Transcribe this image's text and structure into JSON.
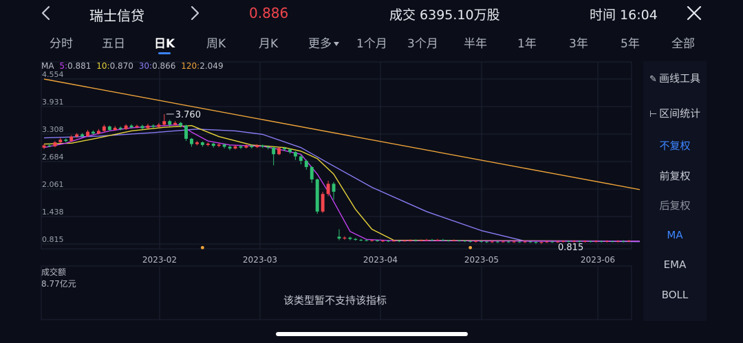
{
  "header": {
    "stock_name": "瑞士信贷",
    "price": "0.886",
    "volume": "成交 6395.10万股",
    "time": "时间 16:04",
    "price_color": "#f2454d"
  },
  "tabs": [
    {
      "label": "分时"
    },
    {
      "label": "五日"
    },
    {
      "label": "日K",
      "active": true
    },
    {
      "label": "周K"
    },
    {
      "label": "月K"
    },
    {
      "label": "更多"
    },
    {
      "label": "1个月"
    },
    {
      "label": "3个月"
    },
    {
      "label": "半年"
    },
    {
      "label": "1年"
    },
    {
      "label": "3年"
    },
    {
      "label": "5年"
    },
    {
      "label": "全部"
    }
  ],
  "ma_legend": {
    "prefix": "MA",
    "ma5": {
      "label": "5:",
      "value": "0.881",
      "color": "#c340f0"
    },
    "ma10": {
      "label": "10:",
      "value": "0.870",
      "color": "#e8d43a"
    },
    "ma30": {
      "label": "30:",
      "value": "0.866",
      "color": "#8a7cf5"
    },
    "ma120": {
      "label": "120:",
      "value": "2.049",
      "color": "#f0a43a"
    }
  },
  "side_panel": {
    "draw_tools": "画线工具",
    "interval_stats": "区间统计",
    "no_adjust": "不复权",
    "forward_adjust": "前复权",
    "backward_adjust": "后复权",
    "ma": "MA",
    "ema": "EMA",
    "boll": "BOLL"
  },
  "volume_panel": {
    "title": "成交额",
    "value": "8.77亿元",
    "message": "该类型暂不支持该指标"
  },
  "chart_data": {
    "type": "candlestick",
    "y_ticks": [
      "4.554",
      "3.931",
      "3.308",
      "2.684",
      "2.061",
      "1.438",
      "0.815"
    ],
    "ylim": [
      0.815,
      4.554
    ],
    "x_ticks": [
      "2023-02",
      "2023-03",
      "2023-04",
      "2023-05",
      "2023-06"
    ],
    "annotations": {
      "high": "3.760",
      "low": "0.815"
    },
    "colors": {
      "up": "#f2454d",
      "down": "#2fbf71",
      "ma5": "#c340f0",
      "ma10": "#e8d43a",
      "ma30": "#8a7cf5",
      "ma120": "#f0a43a",
      "grid": "#1c2133"
    },
    "candles": [
      [
        3.0,
        3.05,
        2.97,
        3.08
      ],
      [
        3.05,
        3.03,
        3.01,
        3.09
      ],
      [
        3.03,
        3.12,
        3.01,
        3.15
      ],
      [
        3.12,
        3.18,
        3.1,
        3.22
      ],
      [
        3.18,
        3.15,
        3.12,
        3.21
      ],
      [
        3.15,
        3.25,
        3.13,
        3.28
      ],
      [
        3.25,
        3.3,
        3.22,
        3.33
      ],
      [
        3.3,
        3.26,
        3.23,
        3.33
      ],
      [
        3.26,
        3.36,
        3.24,
        3.4
      ],
      [
        3.36,
        3.32,
        3.29,
        3.39
      ],
      [
        3.32,
        3.38,
        3.3,
        3.42
      ],
      [
        3.38,
        3.48,
        3.35,
        3.52
      ],
      [
        3.48,
        3.4,
        3.37,
        3.5
      ],
      [
        3.4,
        3.45,
        3.38,
        3.49
      ],
      [
        3.45,
        3.42,
        3.39,
        3.48
      ],
      [
        3.42,
        3.5,
        3.4,
        3.53
      ],
      [
        3.5,
        3.46,
        3.43,
        3.53
      ],
      [
        3.46,
        3.49,
        3.44,
        3.52
      ],
      [
        3.49,
        3.44,
        3.41,
        3.52
      ],
      [
        3.44,
        3.5,
        3.42,
        3.54
      ],
      [
        3.5,
        3.47,
        3.44,
        3.53
      ],
      [
        3.47,
        3.52,
        3.45,
        3.56
      ],
      [
        3.52,
        3.6,
        3.5,
        3.76
      ],
      [
        3.6,
        3.52,
        3.48,
        3.63
      ],
      [
        3.52,
        3.56,
        3.5,
        3.6
      ],
      [
        3.56,
        3.5,
        3.46,
        3.58
      ],
      [
        3.5,
        3.2,
        3.15,
        3.52
      ],
      [
        3.2,
        3.08,
        3.02,
        3.22
      ],
      [
        3.08,
        3.12,
        3.05,
        3.15
      ],
      [
        3.12,
        3.06,
        3.02,
        3.14
      ],
      [
        3.06,
        3.09,
        3.03,
        3.12
      ],
      [
        3.09,
        3.04,
        3.0,
        3.11
      ],
      [
        3.04,
        3.07,
        3.01,
        3.1
      ],
      [
        3.07,
        3.02,
        2.98,
        3.09
      ],
      [
        3.02,
        2.98,
        2.94,
        3.05
      ],
      [
        2.98,
        3.03,
        2.96,
        3.06
      ],
      [
        3.03,
        3.0,
        2.97,
        3.06
      ],
      [
        3.0,
        3.04,
        2.98,
        3.07
      ],
      [
        3.04,
        3.01,
        2.98,
        3.06
      ],
      [
        3.01,
        3.05,
        2.99,
        3.08
      ],
      [
        3.05,
        3.02,
        2.99,
        3.07
      ],
      [
        3.02,
        3.0,
        2.96,
        3.05
      ],
      [
        3.0,
        2.85,
        2.6,
        3.02
      ],
      [
        2.85,
        2.99,
        2.83,
        3.02
      ],
      [
        2.99,
        2.96,
        2.92,
        3.02
      ],
      [
        2.96,
        2.9,
        2.86,
        2.98
      ],
      [
        2.9,
        2.8,
        2.72,
        2.92
      ],
      [
        2.8,
        2.7,
        2.62,
        2.83
      ],
      [
        2.7,
        2.56,
        2.5,
        2.73
      ],
      [
        2.56,
        2.28,
        2.2,
        2.58
      ],
      [
        2.28,
        1.55,
        1.5,
        2.3
      ],
      [
        1.55,
        1.95,
        1.52,
        2.0
      ],
      [
        1.95,
        2.18,
        1.9,
        2.25
      ],
      [
        2.18,
        2.0,
        1.82,
        2.22
      ],
      [
        0.98,
        0.94,
        0.9,
        1.15
      ],
      [
        0.94,
        0.96,
        0.91,
        0.99
      ],
      [
        0.96,
        0.93,
        0.9,
        0.98
      ],
      [
        0.93,
        0.91,
        0.89,
        0.95
      ],
      [
        0.91,
        0.9,
        0.88,
        0.93
      ],
      [
        0.9,
        0.89,
        0.88,
        0.92
      ],
      [
        0.89,
        0.9,
        0.87,
        0.92
      ],
      [
        0.9,
        0.88,
        0.87,
        0.91
      ],
      [
        0.88,
        0.89,
        0.86,
        0.91
      ],
      [
        0.89,
        0.88,
        0.86,
        0.9
      ],
      [
        0.88,
        0.89,
        0.87,
        0.91
      ],
      [
        0.89,
        0.88,
        0.86,
        0.9
      ],
      [
        0.88,
        0.89,
        0.87,
        0.91
      ],
      [
        0.89,
        0.9,
        0.87,
        0.92
      ],
      [
        0.9,
        0.89,
        0.87,
        0.92
      ],
      [
        0.89,
        0.9,
        0.88,
        0.92
      ],
      [
        0.9,
        0.91,
        0.88,
        0.93
      ],
      [
        0.91,
        0.9,
        0.88,
        0.93
      ],
      [
        0.9,
        0.91,
        0.89,
        0.93
      ],
      [
        0.91,
        0.9,
        0.88,
        0.93
      ],
      [
        0.9,
        0.89,
        0.87,
        0.91
      ],
      [
        0.89,
        0.9,
        0.88,
        0.92
      ],
      [
        0.9,
        0.89,
        0.87,
        0.91
      ],
      [
        0.89,
        0.88,
        0.86,
        0.9
      ],
      [
        0.88,
        0.87,
        0.85,
        0.89
      ],
      [
        0.87,
        0.88,
        0.85,
        0.9
      ],
      [
        0.88,
        0.87,
        0.85,
        0.89
      ],
      [
        0.87,
        0.86,
        0.84,
        0.88
      ],
      [
        0.86,
        0.87,
        0.84,
        0.89
      ],
      [
        0.87,
        0.86,
        0.84,
        0.88
      ],
      [
        0.86,
        0.87,
        0.85,
        0.89
      ],
      [
        0.87,
        0.86,
        0.84,
        0.88
      ],
      [
        0.86,
        0.87,
        0.84,
        0.89
      ],
      [
        0.87,
        0.86,
        0.84,
        0.88
      ],
      [
        0.86,
        0.87,
        0.84,
        0.89
      ],
      [
        0.87,
        0.86,
        0.84,
        0.88
      ],
      [
        0.86,
        0.85,
        0.82,
        0.87
      ],
      [
        0.85,
        0.86,
        0.815,
        0.87
      ],
      [
        0.86,
        0.87,
        0.84,
        0.89
      ],
      [
        0.87,
        0.86,
        0.84,
        0.88
      ],
      [
        0.86,
        0.87,
        0.84,
        0.89
      ],
      [
        0.87,
        0.88,
        0.85,
        0.9
      ],
      [
        0.88,
        0.87,
        0.85,
        0.89
      ],
      [
        0.87,
        0.88,
        0.85,
        0.9
      ],
      [
        0.88,
        0.87,
        0.85,
        0.89
      ],
      [
        0.87,
        0.88,
        0.85,
        0.9
      ],
      [
        0.88,
        0.87,
        0.85,
        0.89
      ],
      [
        0.87,
        0.88,
        0.85,
        0.9
      ],
      [
        0.88,
        0.87,
        0.85,
        0.89
      ],
      [
        0.87,
        0.88,
        0.85,
        0.9
      ],
      [
        0.88,
        0.87,
        0.85,
        0.89
      ],
      [
        0.87,
        0.88,
        0.85,
        0.9
      ],
      [
        0.88,
        0.87,
        0.85,
        0.9
      ],
      [
        0.87,
        0.886,
        0.86,
        0.91
      ]
    ],
    "ma5": [
      [
        0,
        3.0
      ],
      [
        4,
        3.1
      ],
      [
        8,
        3.26
      ],
      [
        12,
        3.38
      ],
      [
        16,
        3.45
      ],
      [
        21,
        3.49
      ],
      [
        25,
        3.52
      ],
      [
        27,
        3.35
      ],
      [
        30,
        3.15
      ],
      [
        34,
        3.06
      ],
      [
        40,
        3.03
      ],
      [
        43,
        2.96
      ],
      [
        47,
        2.85
      ],
      [
        50,
        2.4
      ],
      [
        52,
        2.0
      ],
      [
        54,
        1.55
      ],
      [
        56,
        1.1
      ],
      [
        59,
        0.92
      ],
      [
        64,
        0.89
      ],
      [
        109,
        0.88
      ]
    ],
    "ma10": [
      [
        0,
        3.08
      ],
      [
        5,
        3.1
      ],
      [
        10,
        3.22
      ],
      [
        16,
        3.38
      ],
      [
        22,
        3.46
      ],
      [
        27,
        3.5
      ],
      [
        32,
        3.25
      ],
      [
        38,
        3.06
      ],
      [
        44,
        3.0
      ],
      [
        47,
        2.92
      ],
      [
        50,
        2.75
      ],
      [
        53,
        2.4
      ],
      [
        57,
        1.6
      ],
      [
        60,
        1.15
      ],
      [
        64,
        0.9
      ],
      [
        109,
        0.88
      ]
    ],
    "ma30": [
      [
        0,
        3.22
      ],
      [
        10,
        3.26
      ],
      [
        20,
        3.34
      ],
      [
        28,
        3.42
      ],
      [
        35,
        3.38
      ],
      [
        40,
        3.3
      ],
      [
        47,
        3.0
      ],
      [
        52,
        2.65
      ],
      [
        60,
        2.1
      ],
      [
        70,
        1.55
      ],
      [
        80,
        1.12
      ],
      [
        88,
        0.88
      ],
      [
        109,
        0.87
      ]
    ],
    "ma120": [
      [
        0,
        4.554
      ],
      [
        109,
        2.049
      ]
    ],
    "markers": [
      {
        "x": 29,
        "y": 0.78
      },
      {
        "x": 78,
        "y": 0.78
      }
    ]
  }
}
